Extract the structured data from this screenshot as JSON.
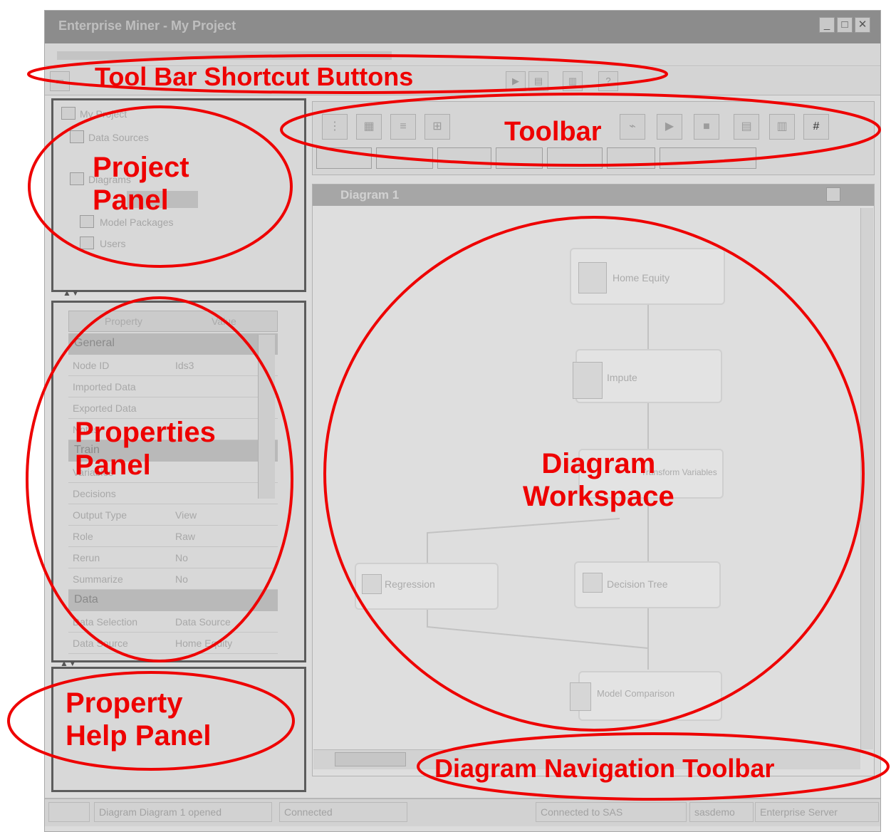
{
  "window": {
    "title": "Enterprise Miner - My Project",
    "minimize_icon": "minimize-icon",
    "maximize_icon": "maximize-icon",
    "close_icon": "close-icon"
  },
  "project_tree": {
    "items": [
      "My Project",
      "Data Sources",
      "Diagrams",
      "Model Packages",
      "Users"
    ]
  },
  "properties": {
    "columns": [
      "Property",
      "Value"
    ],
    "rows": [
      {
        "group": "General"
      },
      {
        "name": "Node ID",
        "value": "Ids3"
      },
      {
        "name": "Imported Data",
        "value": ""
      },
      {
        "name": "Exported Data",
        "value": ""
      },
      {
        "name": "Notes",
        "value": ""
      },
      {
        "group": "Train"
      },
      {
        "name": "Variables",
        "value": ""
      },
      {
        "name": "Decisions",
        "value": ""
      },
      {
        "name": "Output Type",
        "value": "View"
      },
      {
        "name": "Role",
        "value": "Raw"
      },
      {
        "name": "Rerun",
        "value": "No"
      },
      {
        "name": "Summarize",
        "value": "No"
      },
      {
        "group": "Data"
      },
      {
        "name": "Data Selection",
        "value": "Data Source"
      },
      {
        "name": "Data Source",
        "value": "Home Equity"
      }
    ]
  },
  "diagram": {
    "title": "Diagram 1",
    "nodes": [
      "Home Equity",
      "Impute",
      "Transform Variables",
      "Regression",
      "Decision Tree",
      "Model Comparison"
    ]
  },
  "statusbar": {
    "cells": [
      "Diagram Diagram 1 opened",
      "Connected",
      "Connected to SAS",
      "sasdemo",
      "Enterprise Server"
    ]
  },
  "callouts": {
    "toolbar_shortcut": "Tool Bar Shortcut Buttons",
    "toolbar": "Toolbar",
    "project_panel": "Project\nPanel",
    "properties_panel": "Properties\nPanel",
    "property_help": "Property\nHelp Panel",
    "diagram_workspace": "Diagram\nWorkspace",
    "diagram_nav": "Diagram Navigation Toolbar"
  },
  "colors": {
    "annotation": "#ee0000",
    "background": "#ffffff",
    "panel_border": "#5c5c5c"
  }
}
